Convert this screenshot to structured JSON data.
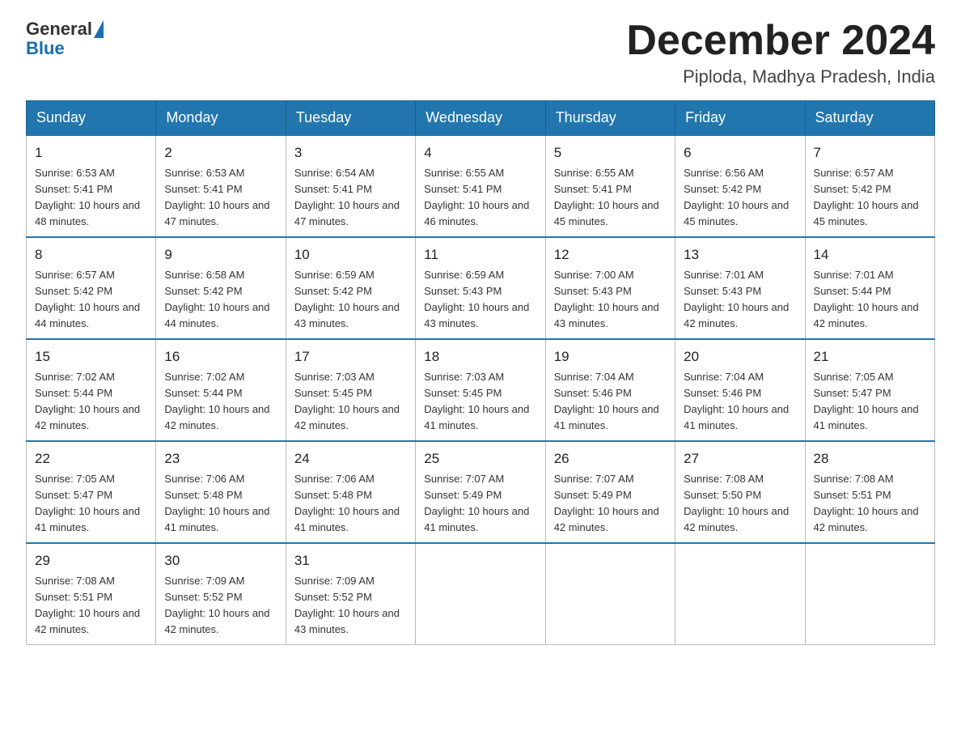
{
  "header": {
    "logo_general": "General",
    "logo_blue": "Blue",
    "month_title": "December 2024",
    "location": "Piploda, Madhya Pradesh, India"
  },
  "weekdays": [
    "Sunday",
    "Monday",
    "Tuesday",
    "Wednesday",
    "Thursday",
    "Friday",
    "Saturday"
  ],
  "weeks": [
    [
      {
        "day": "1",
        "sunrise": "6:53 AM",
        "sunset": "5:41 PM",
        "daylight": "10 hours and 48 minutes."
      },
      {
        "day": "2",
        "sunrise": "6:53 AM",
        "sunset": "5:41 PM",
        "daylight": "10 hours and 47 minutes."
      },
      {
        "day": "3",
        "sunrise": "6:54 AM",
        "sunset": "5:41 PM",
        "daylight": "10 hours and 47 minutes."
      },
      {
        "day": "4",
        "sunrise": "6:55 AM",
        "sunset": "5:41 PM",
        "daylight": "10 hours and 46 minutes."
      },
      {
        "day": "5",
        "sunrise": "6:55 AM",
        "sunset": "5:41 PM",
        "daylight": "10 hours and 45 minutes."
      },
      {
        "day": "6",
        "sunrise": "6:56 AM",
        "sunset": "5:42 PM",
        "daylight": "10 hours and 45 minutes."
      },
      {
        "day": "7",
        "sunrise": "6:57 AM",
        "sunset": "5:42 PM",
        "daylight": "10 hours and 45 minutes."
      }
    ],
    [
      {
        "day": "8",
        "sunrise": "6:57 AM",
        "sunset": "5:42 PM",
        "daylight": "10 hours and 44 minutes."
      },
      {
        "day": "9",
        "sunrise": "6:58 AM",
        "sunset": "5:42 PM",
        "daylight": "10 hours and 44 minutes."
      },
      {
        "day": "10",
        "sunrise": "6:59 AM",
        "sunset": "5:42 PM",
        "daylight": "10 hours and 43 minutes."
      },
      {
        "day": "11",
        "sunrise": "6:59 AM",
        "sunset": "5:43 PM",
        "daylight": "10 hours and 43 minutes."
      },
      {
        "day": "12",
        "sunrise": "7:00 AM",
        "sunset": "5:43 PM",
        "daylight": "10 hours and 43 minutes."
      },
      {
        "day": "13",
        "sunrise": "7:01 AM",
        "sunset": "5:43 PM",
        "daylight": "10 hours and 42 minutes."
      },
      {
        "day": "14",
        "sunrise": "7:01 AM",
        "sunset": "5:44 PM",
        "daylight": "10 hours and 42 minutes."
      }
    ],
    [
      {
        "day": "15",
        "sunrise": "7:02 AM",
        "sunset": "5:44 PM",
        "daylight": "10 hours and 42 minutes."
      },
      {
        "day": "16",
        "sunrise": "7:02 AM",
        "sunset": "5:44 PM",
        "daylight": "10 hours and 42 minutes."
      },
      {
        "day": "17",
        "sunrise": "7:03 AM",
        "sunset": "5:45 PM",
        "daylight": "10 hours and 42 minutes."
      },
      {
        "day": "18",
        "sunrise": "7:03 AM",
        "sunset": "5:45 PM",
        "daylight": "10 hours and 41 minutes."
      },
      {
        "day": "19",
        "sunrise": "7:04 AM",
        "sunset": "5:46 PM",
        "daylight": "10 hours and 41 minutes."
      },
      {
        "day": "20",
        "sunrise": "7:04 AM",
        "sunset": "5:46 PM",
        "daylight": "10 hours and 41 minutes."
      },
      {
        "day": "21",
        "sunrise": "7:05 AM",
        "sunset": "5:47 PM",
        "daylight": "10 hours and 41 minutes."
      }
    ],
    [
      {
        "day": "22",
        "sunrise": "7:05 AM",
        "sunset": "5:47 PM",
        "daylight": "10 hours and 41 minutes."
      },
      {
        "day": "23",
        "sunrise": "7:06 AM",
        "sunset": "5:48 PM",
        "daylight": "10 hours and 41 minutes."
      },
      {
        "day": "24",
        "sunrise": "7:06 AM",
        "sunset": "5:48 PM",
        "daylight": "10 hours and 41 minutes."
      },
      {
        "day": "25",
        "sunrise": "7:07 AM",
        "sunset": "5:49 PM",
        "daylight": "10 hours and 41 minutes."
      },
      {
        "day": "26",
        "sunrise": "7:07 AM",
        "sunset": "5:49 PM",
        "daylight": "10 hours and 42 minutes."
      },
      {
        "day": "27",
        "sunrise": "7:08 AM",
        "sunset": "5:50 PM",
        "daylight": "10 hours and 42 minutes."
      },
      {
        "day": "28",
        "sunrise": "7:08 AM",
        "sunset": "5:51 PM",
        "daylight": "10 hours and 42 minutes."
      }
    ],
    [
      {
        "day": "29",
        "sunrise": "7:08 AM",
        "sunset": "5:51 PM",
        "daylight": "10 hours and 42 minutes."
      },
      {
        "day": "30",
        "sunrise": "7:09 AM",
        "sunset": "5:52 PM",
        "daylight": "10 hours and 42 minutes."
      },
      {
        "day": "31",
        "sunrise": "7:09 AM",
        "sunset": "5:52 PM",
        "daylight": "10 hours and 43 minutes."
      },
      null,
      null,
      null,
      null
    ]
  ]
}
